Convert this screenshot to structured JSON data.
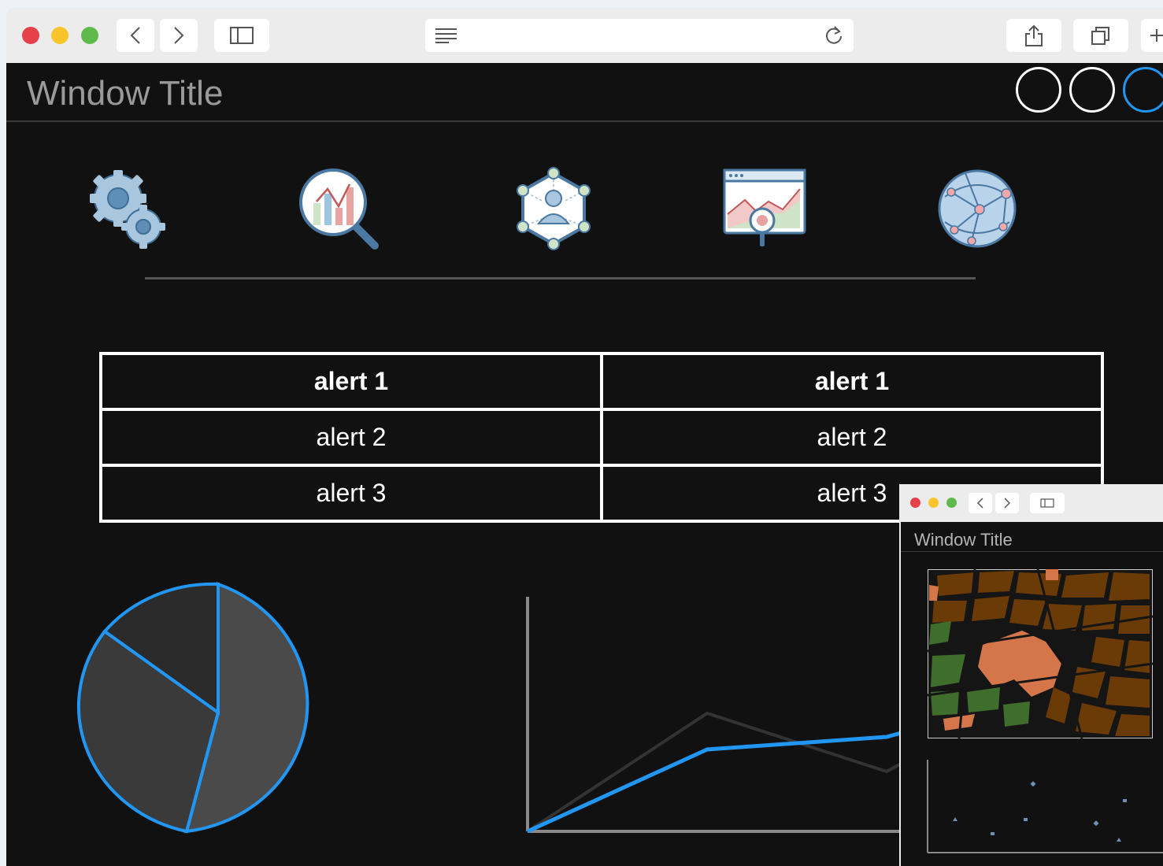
{
  "window": {
    "title": "Window Title"
  },
  "toolbar_icons": [
    "gear-icon",
    "analytics-search-icon",
    "network-user-icon",
    "dashboard-analytics-icon",
    "globe-network-icon"
  ],
  "alerts_table": {
    "rows": [
      [
        "alert 1",
        "alert 1"
      ],
      [
        "alert 2",
        "alert 2"
      ],
      [
        "alert 3",
        "alert 3"
      ]
    ]
  },
  "mini_window": {
    "title": "Window Title"
  },
  "colors": {
    "accent": "#2196f3",
    "background": "#111111",
    "traffic_red": "#e8404a",
    "traffic_yellow": "#f7c52b",
    "traffic_green": "#5dba4b"
  }
}
